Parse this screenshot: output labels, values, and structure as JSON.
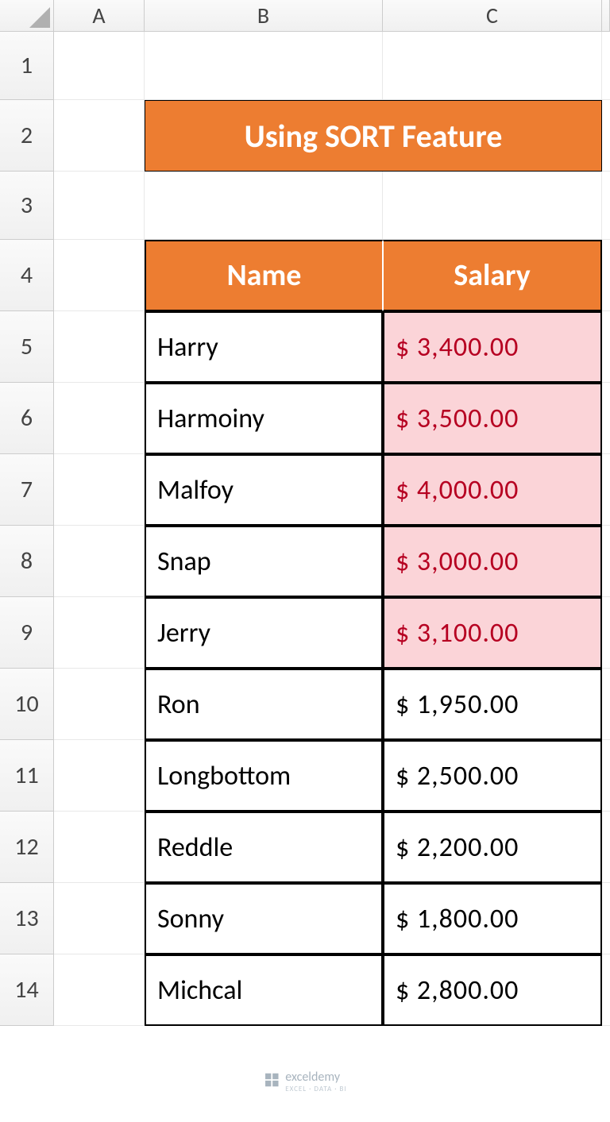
{
  "columns": [
    "A",
    "B",
    "C"
  ],
  "rows": [
    "1",
    "2",
    "3",
    "4",
    "5",
    "6",
    "7",
    "8",
    "9",
    "10",
    "11",
    "12",
    "13",
    "14"
  ],
  "title": "Using SORT Feature",
  "headers": {
    "name": "Name",
    "salary": "Salary"
  },
  "data": [
    {
      "name": "Harry",
      "salary": "$ 3,400.00",
      "highlight": true
    },
    {
      "name": "Harmoiny",
      "salary": "$ 3,500.00",
      "highlight": true
    },
    {
      "name": "Malfoy",
      "salary": "$ 4,000.00",
      "highlight": true
    },
    {
      "name": "Snap",
      "salary": "$ 3,000.00",
      "highlight": true
    },
    {
      "name": "Jerry",
      "salary": "$ 3,100.00",
      "highlight": true
    },
    {
      "name": "Ron",
      "salary": "$ 1,950.00",
      "highlight": false
    },
    {
      "name": "Longbottom",
      "salary": "$ 2,500.00",
      "highlight": false
    },
    {
      "name": "Reddle",
      "salary": "$ 2,200.00",
      "highlight": false
    },
    {
      "name": "Sonny",
      "salary": "$ 1,800.00",
      "highlight": false
    },
    {
      "name": "Michcal",
      "salary": "$ 2,800.00",
      "highlight": false
    }
  ],
  "watermark": {
    "brand": "exceldemy",
    "tag": "EXCEL · DATA · BI"
  }
}
